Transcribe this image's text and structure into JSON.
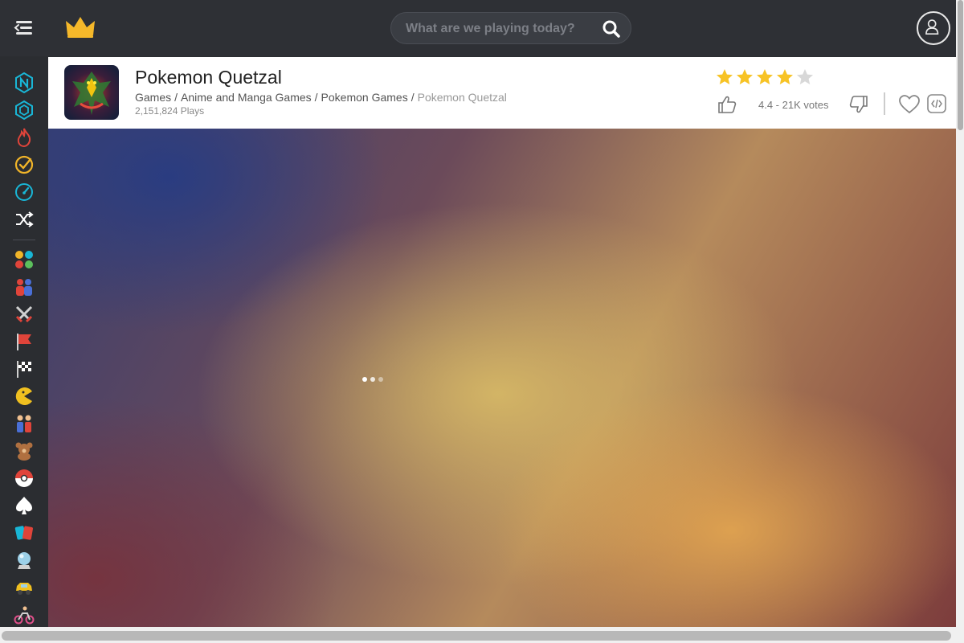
{
  "header": {
    "search_placeholder": "What are we playing today?"
  },
  "sidebar": {
    "items": [
      {
        "icon": "new-icon",
        "color": "#19b6d6"
      },
      {
        "icon": "cube-icon",
        "color": "#19b6d6"
      },
      {
        "icon": "fire-icon",
        "color": "#e0443a"
      },
      {
        "icon": "check-circle-icon",
        "color": "#f0b429"
      },
      {
        "icon": "speedometer-icon",
        "color": "#19b6d6"
      },
      {
        "icon": "shuffle-icon",
        "color": "#ffffff"
      },
      {
        "icon": "all-categories-icon",
        "color": "#f0b429"
      },
      {
        "icon": "two-player-icon",
        "color": "#4a6fd6"
      },
      {
        "icon": "swords-icon",
        "color": "#c0c0c0"
      },
      {
        "icon": "flag-icon",
        "color": "#e0443a"
      },
      {
        "icon": "racing-flag-icon",
        "color": "#ffffff"
      },
      {
        "icon": "pacman-icon",
        "color": "#f0c020"
      },
      {
        "icon": "people-icon",
        "color": "#4a6fd6"
      },
      {
        "icon": "teddy-bear-icon",
        "color": "#b07040"
      },
      {
        "icon": "pokeball-icon",
        "color": "#e0443a"
      },
      {
        "icon": "spade-icon",
        "color": "#ffffff"
      },
      {
        "icon": "cards-icon",
        "color": "#e0443a"
      },
      {
        "icon": "crystal-ball-icon",
        "color": "#9cd0e8"
      },
      {
        "icon": "car-icon",
        "color": "#f0c020"
      },
      {
        "icon": "bike-icon",
        "color": "#e04f8a"
      }
    ]
  },
  "game": {
    "title": "Pokemon Quetzal",
    "breadcrumb": [
      "Games",
      "Anime and Manga Games",
      "Pokemon Games",
      "Pokemon Quetzal"
    ],
    "plays": "2,151,824 Plays",
    "rating": 4.4,
    "votes": "4.4 - 21K votes"
  },
  "colors": {
    "star_filled": "#f7c325",
    "star_empty": "#d8d8d8",
    "top_bar": "#2e3035",
    "logo": "#f5b82a"
  }
}
